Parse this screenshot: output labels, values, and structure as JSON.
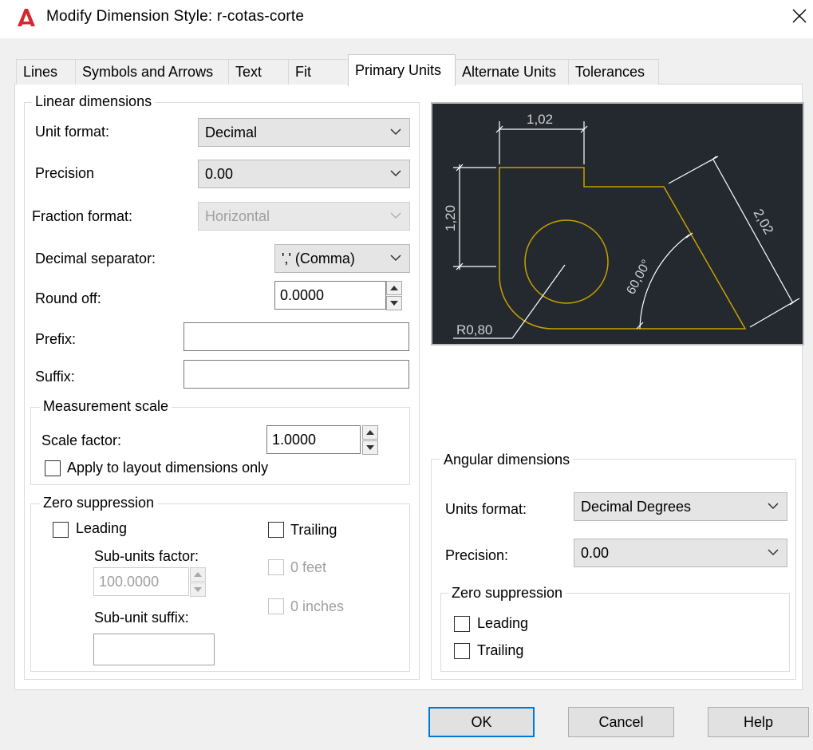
{
  "window": {
    "title": "Modify Dimension Style: r-cotas-corte",
    "app_icon": "autocad-logo-icon",
    "close_icon": "close-icon"
  },
  "tabs": [
    {
      "label": "Lines",
      "active": false
    },
    {
      "label": "Symbols and Arrows",
      "active": false
    },
    {
      "label": "Text",
      "active": false
    },
    {
      "label": "Fit",
      "active": false
    },
    {
      "label": "Primary Units",
      "active": true
    },
    {
      "label": "Alternate Units",
      "active": false
    },
    {
      "label": "Tolerances",
      "active": false
    }
  ],
  "linear": {
    "group_label": "Linear dimensions",
    "unit_format": {
      "label": "Unit format:",
      "value": "Decimal"
    },
    "precision": {
      "label": "Precision",
      "value": "0.00"
    },
    "fraction_format": {
      "label": "Fraction format:",
      "value": "Horizontal",
      "enabled": false
    },
    "decimal_separator": {
      "label": "Decimal separator:",
      "value": "',' (Comma)"
    },
    "round_off": {
      "label": "Round off:",
      "value": "0.0000"
    },
    "prefix": {
      "label": "Prefix:",
      "value": ""
    },
    "suffix": {
      "label": "Suffix:",
      "value": ""
    }
  },
  "measurement_scale": {
    "group_label": "Measurement scale",
    "scale_factor": {
      "label": "Scale factor:",
      "value": "1.0000"
    },
    "apply_layout": {
      "label": "Apply to layout dimensions only",
      "checked": false
    }
  },
  "zero_suppression_linear": {
    "group_label": "Zero suppression",
    "leading": {
      "label": "Leading",
      "checked": false
    },
    "trailing": {
      "label": "Trailing",
      "checked": false
    },
    "sub_units_factor": {
      "label": "Sub-units factor:",
      "value": "100.0000",
      "enabled": false
    },
    "feet": {
      "label": "0 feet",
      "checked": false,
      "enabled": false
    },
    "sub_unit_suffix": {
      "label": "Sub-unit suffix:",
      "value": ""
    },
    "inches": {
      "label": "0 inches",
      "checked": false,
      "enabled": false
    }
  },
  "preview": {
    "dim_horizontal": "1,02",
    "dim_vertical": "1,20",
    "dim_aligned": "2,02",
    "dim_angle": "60,00°",
    "dim_radius": "R0,80",
    "colors": {
      "background": "#242930",
      "geometry": "#c8a000",
      "dimensions": "#ffffff"
    }
  },
  "angular": {
    "group_label": "Angular dimensions",
    "units_format": {
      "label": "Units format:",
      "value": "Decimal Degrees"
    },
    "precision": {
      "label": "Precision:",
      "value": "0.00"
    },
    "zero_suppression": {
      "group_label": "Zero suppression",
      "leading": {
        "label": "Leading",
        "checked": false
      },
      "trailing": {
        "label": "Trailing",
        "checked": false
      }
    }
  },
  "buttons": {
    "ok": "OK",
    "cancel": "Cancel",
    "help": "Help"
  },
  "accent": "#0078d7"
}
